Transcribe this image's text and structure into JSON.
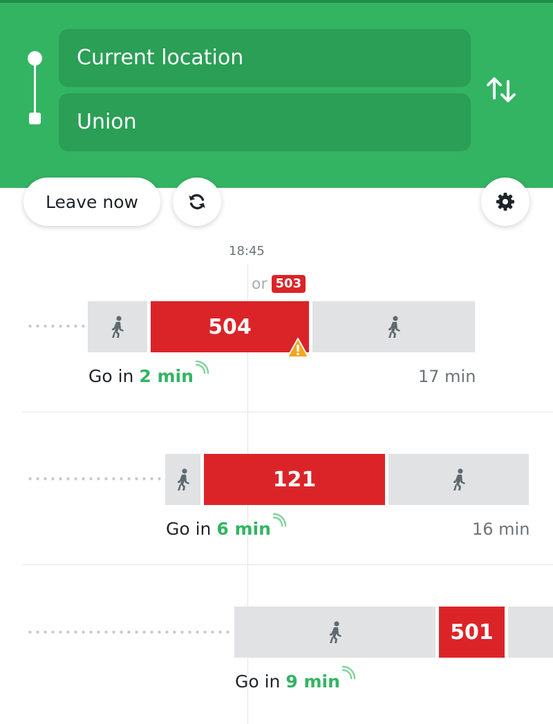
{
  "search": {
    "from": "Current location",
    "to": "Union"
  },
  "controls": {
    "leave_now": "Leave now",
    "refresh_icon": "refresh-icon",
    "settings_icon": "gear-icon",
    "swap_icon": "swap-arrows-icon"
  },
  "timeline": {
    "current_time": "18:45"
  },
  "trips": [
    {
      "alt_prefix": "or",
      "alt_route": "503",
      "route": "504",
      "go_prefix": "Go in",
      "go_mins": "2 min",
      "duration": "17 min",
      "alert_icon": "warning-icon"
    },
    {
      "route": "121",
      "go_prefix": "Go in",
      "go_mins": "6 min",
      "duration": "16 min"
    },
    {
      "route": "501",
      "go_prefix": "Go in",
      "go_mins": "9 min"
    }
  ],
  "colors": {
    "header_green": "#33b463",
    "field_green": "#2a9f55",
    "route_red": "#db2428",
    "walk_gray": "#e1e2e3",
    "realtime_green": "#33b463"
  }
}
